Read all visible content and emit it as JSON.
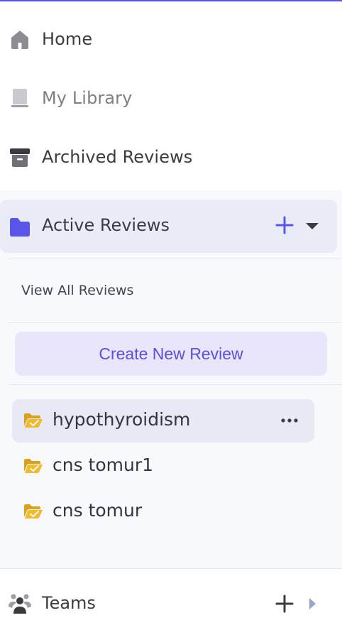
{
  "nav": {
    "home": {
      "label": "Home",
      "icon": "home-icon"
    },
    "library": {
      "label": "My Library",
      "icon": "library-icon"
    },
    "archived": {
      "label": "Archived Reviews",
      "icon": "archive-icon"
    }
  },
  "active_reviews": {
    "label": "Active Reviews",
    "icon": "folder-icon",
    "view_all_label": "View All Reviews",
    "create_label": "Create New Review",
    "items": [
      {
        "label": "hypothyroidism",
        "selected": true
      },
      {
        "label": "cns tomur1",
        "selected": false
      },
      {
        "label": "cns tomur",
        "selected": false
      }
    ]
  },
  "teams": {
    "label": "Teams",
    "icon": "teams-icon"
  },
  "colors": {
    "accent": "#5b54e8",
    "folder_yellow": "#f2b92a",
    "selected_bg": "#e7eaf5",
    "create_bg": "#e9e6fc"
  }
}
